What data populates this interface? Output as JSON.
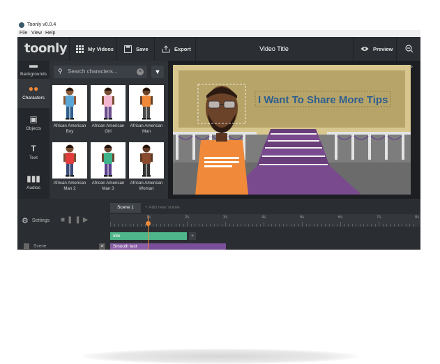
{
  "app": {
    "title": "Toonly v0.0.4"
  },
  "menu": [
    "File",
    "View",
    "Help"
  ],
  "toolbar": {
    "logo": "toonly",
    "my_videos": "My Videos",
    "save": "Save",
    "export": "Export",
    "video_title": "Video Title",
    "preview": "Preview"
  },
  "nav": [
    {
      "label": "Backgrounds",
      "icon": "backgrounds-icon"
    },
    {
      "label": "Characters",
      "icon": "characters-icon"
    },
    {
      "label": "Objects",
      "icon": "objects-icon"
    },
    {
      "label": "Text",
      "icon": "text-icon"
    },
    {
      "label": "Audios",
      "icon": "audios-icon"
    }
  ],
  "search": {
    "placeholder": "Search characters..."
  },
  "characters": [
    {
      "name": "African American Boy",
      "shirt": "#5aa6d6",
      "pants": "#2f5f8f",
      "skin": "#8a5a3c"
    },
    {
      "name": "African American Girl",
      "shirt": "#f3b6cf",
      "pants": "#6b4d8c",
      "skin": "#7a4e32"
    },
    {
      "name": "African American Man",
      "shirt": "#f08a3a",
      "pants": "#4a4a4a",
      "skin": "#6b4329"
    },
    {
      "name": "African American Man 2",
      "shirt": "#e23c3c",
      "pants": "#3a4a7a",
      "skin": "#7b4f33"
    },
    {
      "name": "African American Man 3",
      "shirt": "#3fb38a",
      "pants": "#5b3f8c",
      "skin": "#6a4530"
    },
    {
      "name": "African American Woman",
      "shirt": "#8a4b2f",
      "pants": "#333333",
      "skin": "#5f3a24"
    }
  ],
  "stage": {
    "text": "I Want To Share More Tips"
  },
  "timeline": {
    "scene_tab": "Scene 1",
    "add_scene": "Add new scene",
    "settings": "Settings",
    "ticks": [
      "1s",
      "2s",
      "3s",
      "4s",
      "5s",
      "6s",
      "7s",
      "8s"
    ],
    "idle": "Idle",
    "smooth": "Smooth text",
    "scene_label": "Scene"
  }
}
